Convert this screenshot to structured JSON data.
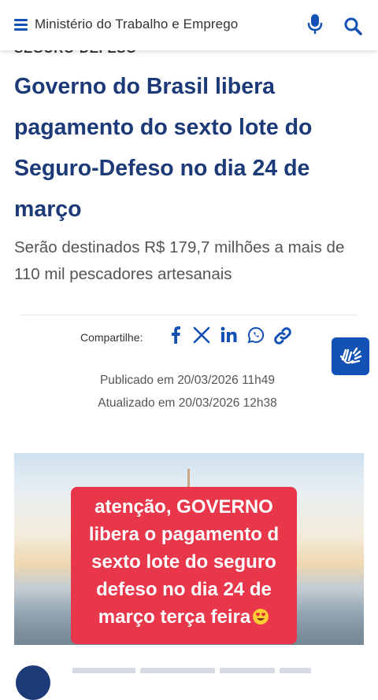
{
  "header": {
    "title": "Ministério do Trabalho e Emprego",
    "menu_icon": "hamburger-menu-icon",
    "mic_icon": "microphone-icon",
    "search_icon": "search-icon",
    "accent_color": "#1351b4"
  },
  "article": {
    "category": "SEGURO-DEFESO",
    "title": "Governo do Brasil libera pagamento do sexto lote do Seguro-Defeso no dia 24 de março",
    "subtitle": "Serão destinados R$ 179,7 milhões a mais de 110 mil pescadores artesanais",
    "title_color": "#1c3a78"
  },
  "share": {
    "label": "Compartilhe:",
    "icons": [
      "facebook-icon",
      "x-icon",
      "linkedin-icon",
      "whatsapp-icon",
      "copy-link-icon"
    ]
  },
  "dates": {
    "published": "Publicado em 20/03/2026 11h49",
    "updated": "Atualizado em 20/03/2026 12h38"
  },
  "accessibility_button": {
    "icon": "sign-language-hands-icon"
  },
  "sticker": {
    "lines": [
      "atenção, GOVERNO",
      "libera o pagamento d",
      "sexto lote  do seguro",
      "defeso no dia 24 de",
      "março terça feira"
    ],
    "emoji": "smiling-face-with-heart-eyes",
    "background": "#e8364a"
  }
}
